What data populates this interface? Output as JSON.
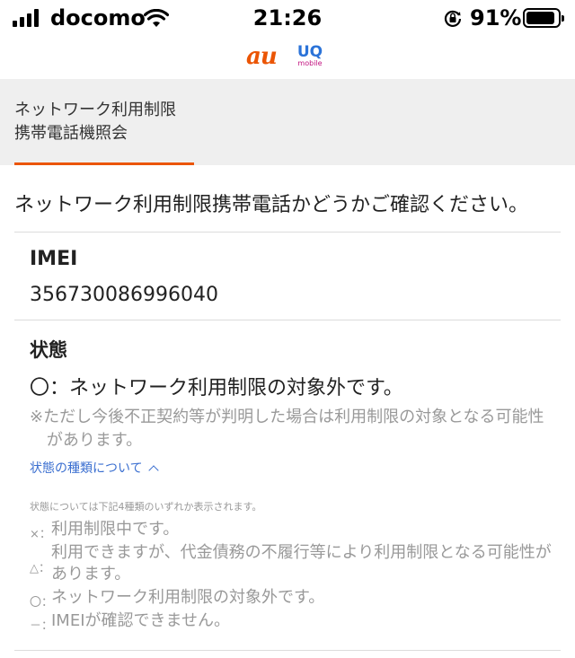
{
  "status_bar": {
    "carrier": "docomo",
    "time": "21:26",
    "battery_pct": "91%",
    "battery_level": 0.91
  },
  "logos": {
    "au": "au",
    "uq": "UQ",
    "uq_sub": "mobile"
  },
  "tab": {
    "title": "ネットワーク利用制限\n携帯電話機照会",
    "accent": "#eb5505"
  },
  "question": "ネットワーク利用制限携帯電話かどうかご確認ください。",
  "imei": {
    "label": "IMEI",
    "value": "356730086996040"
  },
  "status": {
    "label": "状態",
    "value": "〇：ネットワーク利用制限の対象外です。",
    "note": "※ただし今後不正契約等が判明した場合は利用制限の対象となる可能性があります。"
  },
  "types": {
    "link": "状態の種類について",
    "intro": "状態については下記4種類のいずれか表示されます。",
    "items": [
      {
        "symbol": "×：",
        "text": "利用制限中です。"
      },
      {
        "symbol": "△：",
        "text": "利用できますが、代金債務の不履行等により利用制限となる可能性があります。"
      },
      {
        "symbol": "〇：",
        "text": "ネットワーク利用制限の対象外です。"
      },
      {
        "symbol": "－：",
        "text": "IMEIが確認できません。"
      }
    ]
  }
}
